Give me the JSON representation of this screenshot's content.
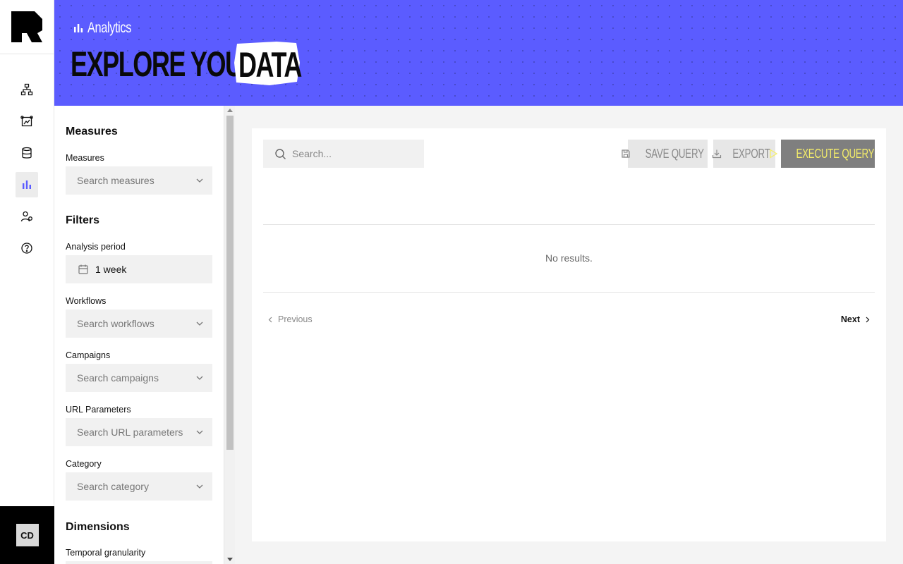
{
  "rail": {
    "avatar_initials": "CD",
    "nav_icons": [
      "workflow-icon",
      "flows-icon",
      "database-icon",
      "analytics-icon",
      "users-icon",
      "help-icon"
    ],
    "active_index": 3
  },
  "header": {
    "section": "Analytics",
    "headline_main": "EXPLORE YOUR",
    "headline_highlight": "DATA",
    "bg_color": "#5b5cff"
  },
  "sidebar": {
    "measures_title": "Measures",
    "measures_label": "Measures",
    "measures_placeholder": "Search measures",
    "filters_title": "Filters",
    "analysis_label": "Analysis period",
    "analysis_value": "1 week",
    "workflows_label": "Workflows",
    "workflows_placeholder": "Search workflows",
    "campaigns_label": "Campaigns",
    "campaigns_placeholder": "Search campaigns",
    "url_label": "URL Parameters",
    "url_placeholder": "Search URL parameters",
    "category_label": "Category",
    "category_placeholder": "Search category",
    "dimensions_title": "Dimensions",
    "temporal_label": "Temporal granularity"
  },
  "main": {
    "search_placeholder": "Search...",
    "save_label": "SAVE QUERY",
    "export_label": "EXPORT",
    "execute_label": "EXECUTE QUERY",
    "empty_text": "No results.",
    "prev_label": "Previous",
    "next_label": "Next"
  }
}
